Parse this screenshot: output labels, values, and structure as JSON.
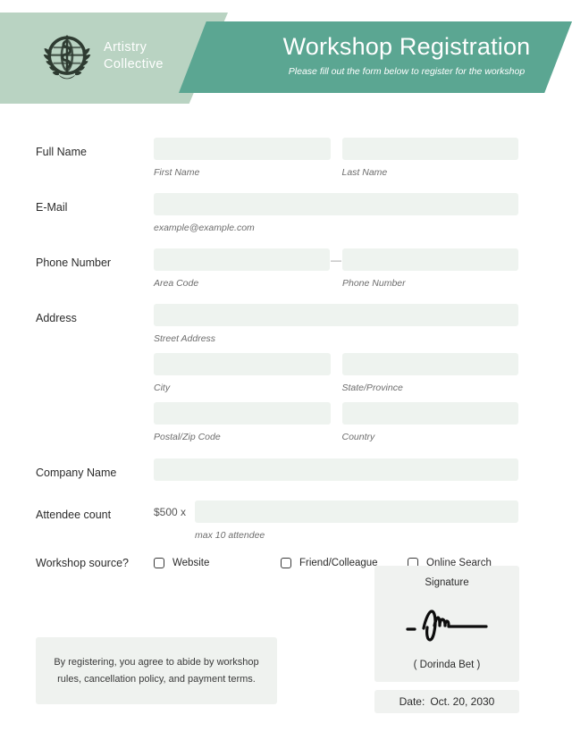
{
  "header": {
    "logo_icon": "who-emblem-globe-laurel-icon",
    "brand_line1": "Artistry",
    "brand_line2": "Collective",
    "title": "Workshop Registration",
    "subtitle": "Please fill out the form below to register for the workshop",
    "colors": {
      "band_light": "#b9d3c2",
      "band_dark": "#5ba692",
      "title_text": "#ffffff"
    }
  },
  "form": {
    "full_name": {
      "label": "Full Name",
      "first_sublabel": "First Name",
      "last_sublabel": "Last Name",
      "first_value": "",
      "last_value": ""
    },
    "email": {
      "label": "E-Mail",
      "sublabel": "example@example.com",
      "value": ""
    },
    "phone": {
      "label": "Phone Number",
      "separator": "—",
      "area_sublabel": "Area Code",
      "number_sublabel": "Phone Number",
      "area_value": "",
      "number_value": ""
    },
    "address": {
      "label": "Address",
      "street_sublabel": "Street Address",
      "city_sublabel": "City",
      "state_sublabel": "State/Province",
      "postal_sublabel": "Postal/Zip Code",
      "country_sublabel": "Country",
      "street_value": "",
      "city_value": "",
      "state_value": "",
      "postal_value": "",
      "country_value": ""
    },
    "company": {
      "label": "Company Name",
      "value": ""
    },
    "attendee": {
      "label": "Attendee count",
      "price_prefix": "$500 x",
      "sublabel": "max 10 attendee",
      "value": ""
    },
    "source": {
      "label": "Workshop source?",
      "options": [
        {
          "label": "Website",
          "checked": false
        },
        {
          "label": "Friend/Colleague",
          "checked": false
        },
        {
          "label": "Online Search",
          "checked": false
        }
      ]
    }
  },
  "footer": {
    "terms_text": "By registering, you agree to abide by workshop rules, cancellation policy, and payment terms.",
    "signature": {
      "title": "Signature",
      "mark_icon": "handwritten-signature-scribble-icon",
      "name": "( Dorinda Bet )"
    },
    "date": {
      "label": "Date:",
      "value": "Oct. 20, 2030"
    }
  }
}
